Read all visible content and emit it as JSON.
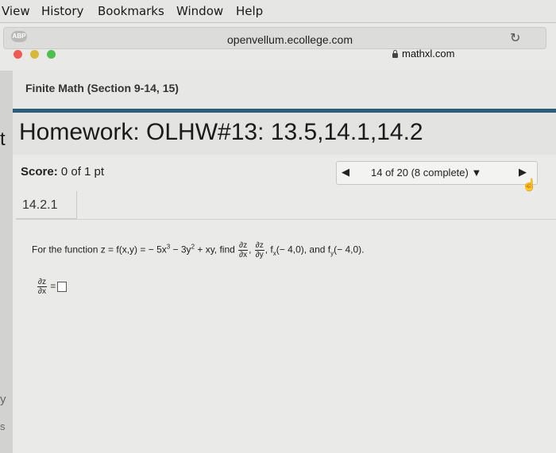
{
  "menubar": {
    "items": [
      "View",
      "History",
      "Bookmarks",
      "Window",
      "Help"
    ]
  },
  "browser": {
    "abp_badge": "ABP",
    "url_top": "openvellum.ecollege.com",
    "tab_url": "mathxl.com"
  },
  "course": {
    "title": "Finite Math (Section 9-14, 15)"
  },
  "homework": {
    "title": "Homework: OLHW#13: 13.5,14.1,14.2",
    "edge_char": "t"
  },
  "score": {
    "label": "Score:",
    "value": "0 of 1 pt"
  },
  "question_nav": {
    "prev": "◀",
    "label": "14 of 20 (8 complete) ▼",
    "next": "▶"
  },
  "question": {
    "number": "14.2.1",
    "prefix": "For the function z = f(x,y) = − 5x",
    "exp1": "3",
    "mid1": " − 3y",
    "exp2": "2",
    "mid2": " + xy, find ",
    "dz": "∂z",
    "dx": "∂x",
    "dy": "∂y",
    "comma": ", ",
    "f": "f",
    "x": "x",
    "y": "y",
    "arg": "(− 4,0)",
    "and": ", and ",
    "end": "."
  },
  "answer": {
    "num": "∂z",
    "den": "∂x",
    "eq": "="
  },
  "edge": {
    "y": "y",
    "s": "s"
  }
}
